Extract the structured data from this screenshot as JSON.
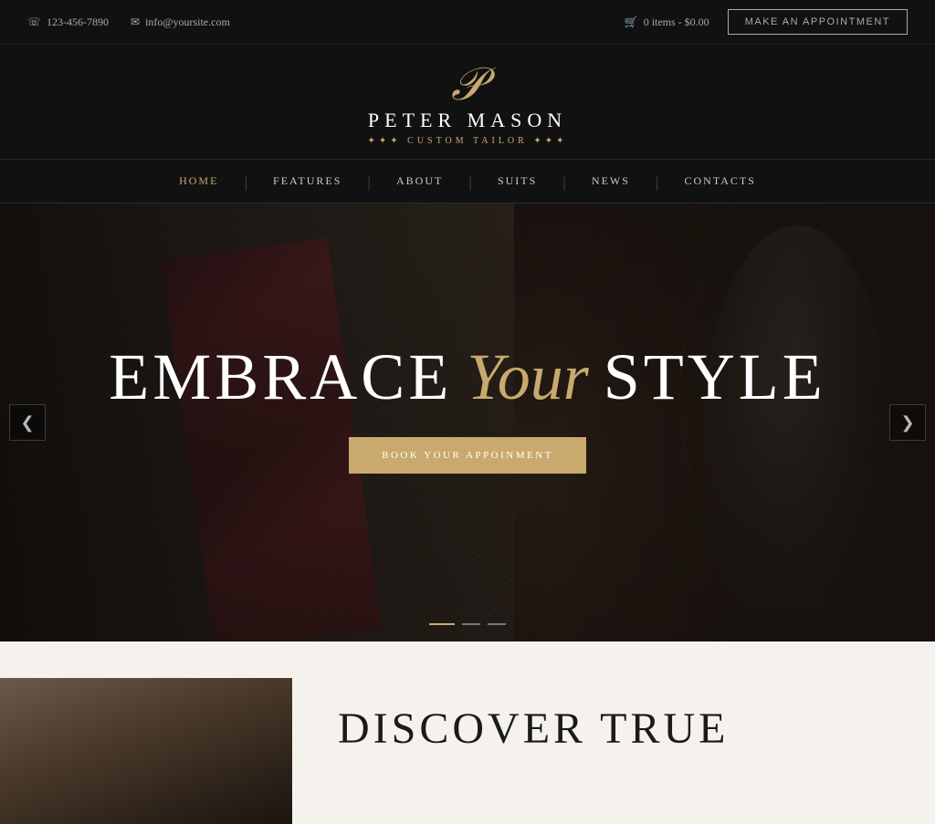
{
  "topbar": {
    "phone": "123-456-7890",
    "email": "info@yoursite.com",
    "cart": "0 items - $0.00",
    "appointment_btn": "MAKE AN APPOINTMENT"
  },
  "logo": {
    "monogram": "P",
    "name": "PETER MASON",
    "subtitle": "✦✦✦  CUSTOM TAILOR  ✦✦✦"
  },
  "nav": {
    "items": [
      {
        "label": "HOME",
        "active": true
      },
      {
        "label": "FEATURES",
        "active": false
      },
      {
        "label": "ABOUT",
        "active": false
      },
      {
        "label": "SUITS",
        "active": false
      },
      {
        "label": "NEWS",
        "active": false
      },
      {
        "label": "CONTACTS",
        "active": false
      }
    ]
  },
  "hero": {
    "title_before": "EMBRACE",
    "title_italic": "Your",
    "title_after": "STYLE",
    "cta_label": "BOOK YOUR APPOINMENT"
  },
  "slider": {
    "arrow_left": "❮",
    "arrow_right": "❯",
    "dots": [
      true,
      false,
      false
    ]
  },
  "below_fold": {
    "discover_title": "DISCOVER TRUE"
  }
}
